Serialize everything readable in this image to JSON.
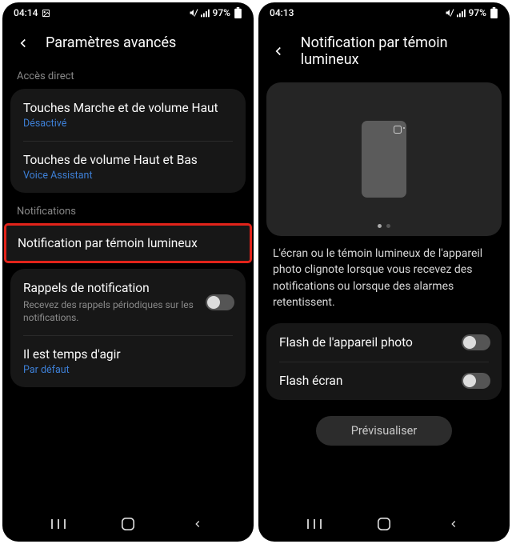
{
  "left": {
    "status": {
      "time": "04:14",
      "battery": "97%"
    },
    "title": "Paramètres avancés",
    "section1_label": "Accès direct",
    "row1": {
      "title": "Touches Marche et de volume Haut",
      "sub": "Désactivé"
    },
    "row2": {
      "title": "Touches de volume Haut et Bas",
      "sub": "Voice Assistant"
    },
    "section2_label": "Notifications",
    "row3": {
      "title": "Notification par témoin lumineux"
    },
    "row4": {
      "title": "Rappels de notification",
      "sub": "Recevez des rappels périodiques sur les notifications."
    },
    "row5": {
      "title": "Il est temps d'agir",
      "sub": "Par défaut"
    }
  },
  "right": {
    "status": {
      "time": "04:13",
      "battery": "97%"
    },
    "title": "Notification par témoin lumineux",
    "description": "L'écran ou le témoin lumineux de l'appareil photo clignote lorsque vous recevez des notifications ou lorsque des alarmes retentissent.",
    "row1": {
      "title": "Flash de l'appareil photo"
    },
    "row2": {
      "title": "Flash écran"
    },
    "preview_btn": "Prévisualiser"
  }
}
